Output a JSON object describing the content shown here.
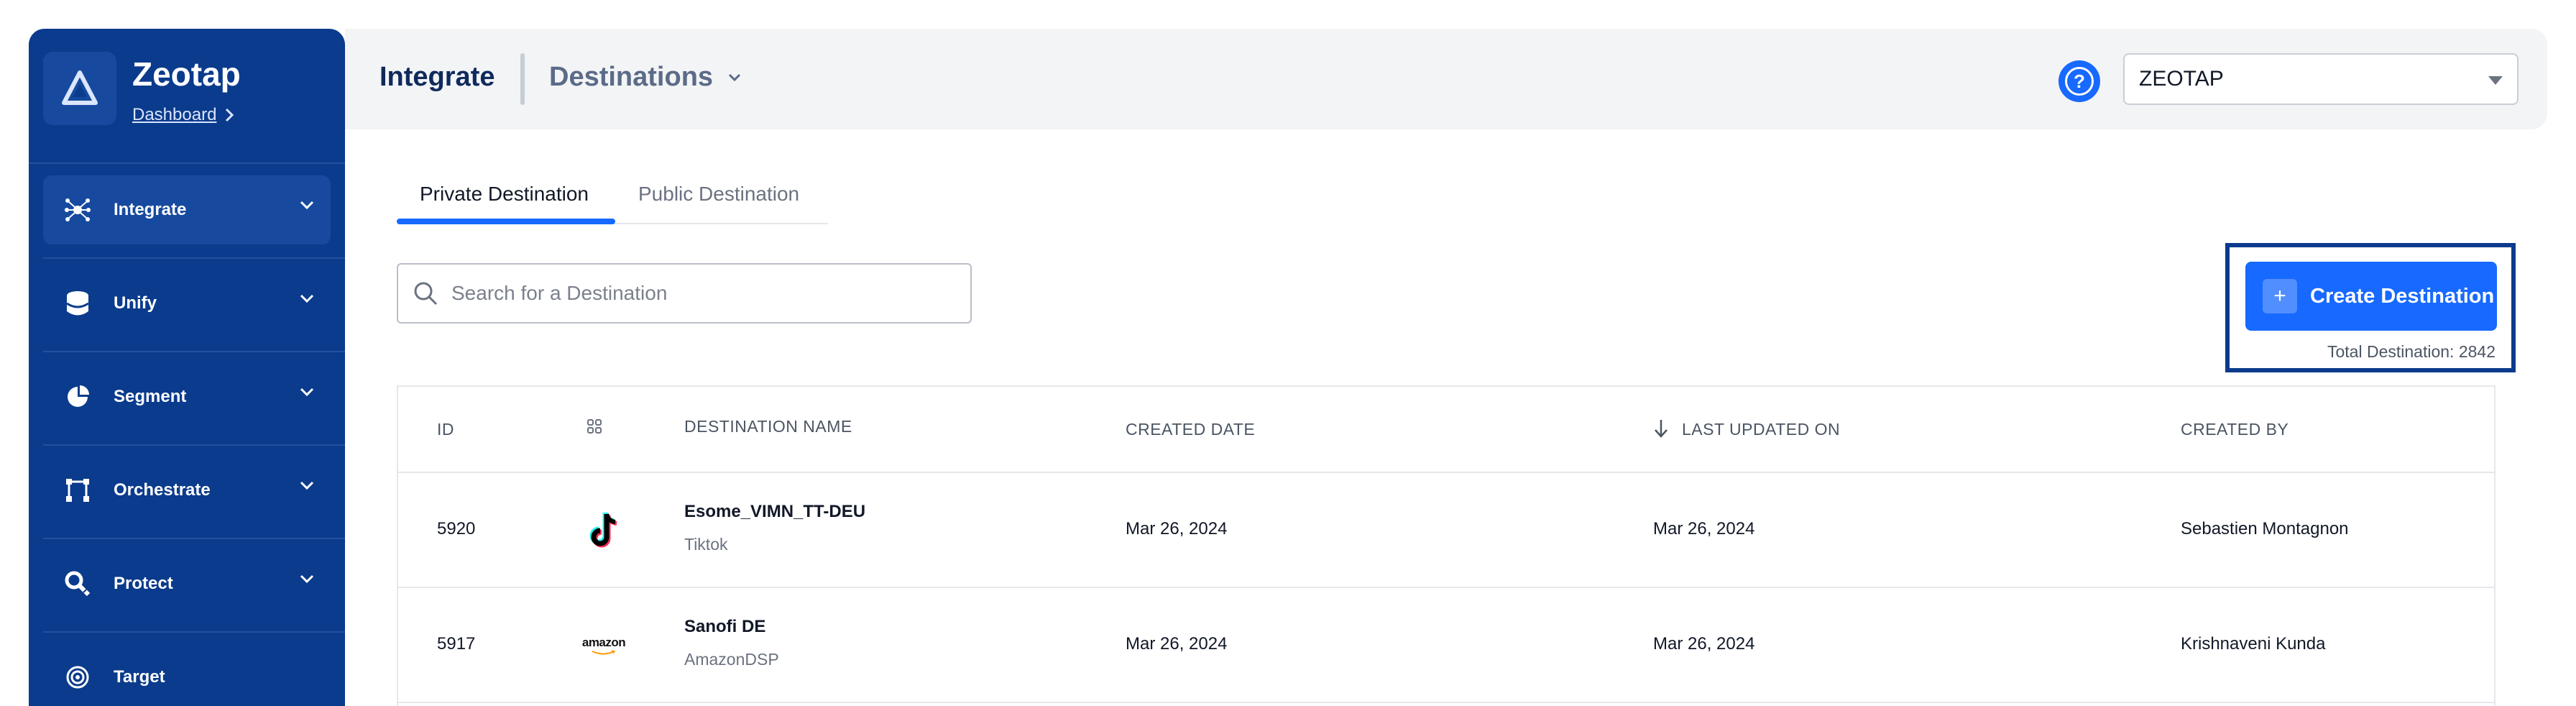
{
  "brand": {
    "title": "Zeotap",
    "link": "Dashboard"
  },
  "sidebar": {
    "items": [
      {
        "label": "Integrate",
        "icon": "integrate-icon"
      },
      {
        "label": "Unify",
        "icon": "database-icon"
      },
      {
        "label": "Segment",
        "icon": "pie-chart-icon"
      },
      {
        "label": "Orchestrate",
        "icon": "orchestrate-icon"
      },
      {
        "label": "Protect",
        "icon": "protect-icon"
      },
      {
        "label": "Target",
        "icon": "target-icon"
      }
    ]
  },
  "header": {
    "title": "Integrate",
    "subtitle": "Destinations",
    "help": "?",
    "org": "ZEOTAP"
  },
  "tabs": [
    {
      "label": "Private Destination"
    },
    {
      "label": "Public Destination"
    }
  ],
  "search": {
    "placeholder": "Search for a Destination"
  },
  "create": {
    "plus": "+",
    "label": "Create Destination",
    "total": "Total Destination: 2842"
  },
  "table": {
    "headers": {
      "id": "ID",
      "name": "DESTINATION NAME",
      "created": "CREATED DATE",
      "updated": "LAST UPDATED ON",
      "by": "CREATED BY"
    },
    "rows": [
      {
        "id": "5920",
        "name": "Esome_VIMN_TT-DEU",
        "type": "Tiktok",
        "logo": "tiktok-logo",
        "created": "Mar 26, 2024",
        "updated": "Mar 26, 2024",
        "by": "Sebastien Montagnon"
      },
      {
        "id": "5917",
        "name": "Sanofi DE",
        "type": "AmazonDSP",
        "logo_text": "amazon",
        "created": "Mar 26, 2024",
        "updated": "Mar 26, 2024",
        "by": "Krishnaveni Kunda"
      }
    ]
  },
  "colors": {
    "sidebar": "#0b3b8c",
    "accent": "#1769ff",
    "header_bg": "#f3f4f6"
  }
}
